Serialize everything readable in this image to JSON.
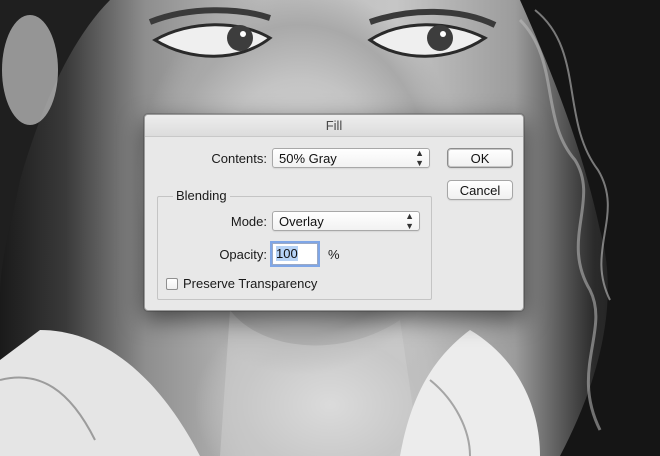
{
  "dialog": {
    "title": "Fill",
    "contents_label": "Contents:",
    "contents_value": "50% Gray",
    "ok_label": "OK",
    "cancel_label": "Cancel",
    "blending": {
      "group_title": "Blending",
      "mode_label": "Mode:",
      "mode_value": "Overlay",
      "opacity_label": "Opacity:",
      "opacity_value": "100",
      "opacity_unit": "%",
      "preserve_label": "Preserve Transparency",
      "preserve_checked": false
    }
  },
  "icons": {
    "select_chevron": "up-down-chevron-icon"
  },
  "colors": {
    "focus_ring": "#7fa6e6",
    "selection": "#b6d2f5",
    "dialog_bg": "#e8e8e8"
  }
}
